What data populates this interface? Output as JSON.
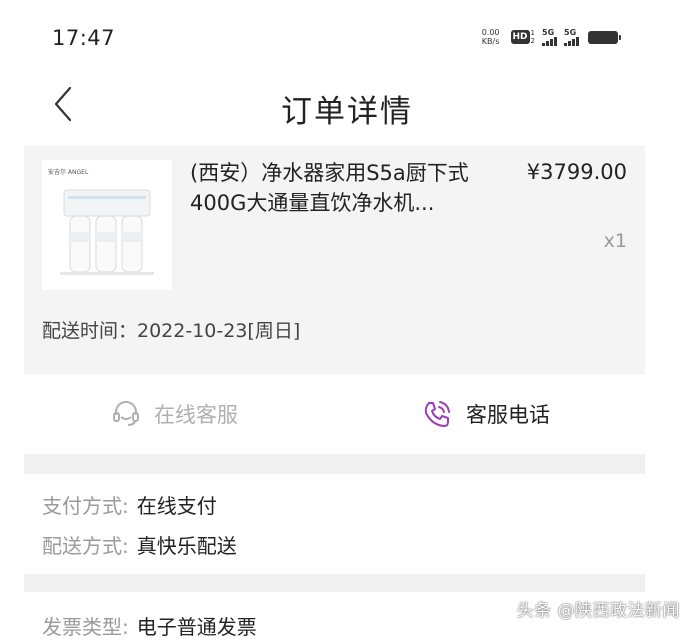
{
  "status_bar": {
    "time": "17:47",
    "net_speed_value": "0.00",
    "net_speed_unit": "KB/s",
    "hd_label": "HD",
    "hd_sub_top": "1",
    "hd_sub_bottom": "2",
    "signal_1_label": "5G",
    "signal_2_label": "5G"
  },
  "nav": {
    "title": "订单详情"
  },
  "product": {
    "brand_text": "安吉尔 ANGEL",
    "name": "(西安）净水器家用S5a厨下式400G大通量直饮净水机...",
    "price": "¥3799.00",
    "quantity": "x1",
    "delivery_time": "配送时间：2022-10-23[周日]"
  },
  "service": {
    "online_label": "在线客服",
    "phone_label": "客服电话"
  },
  "info": {
    "payment_label": "支付方式:",
    "payment_value": "在线支付",
    "delivery_label": "配送方式:",
    "delivery_value": "真快乐配送",
    "invoice_label": "发票类型:",
    "invoice_value": "电子普通发票"
  },
  "watermark": "头条 @陕西政法新闻",
  "colors": {
    "phone_icon": "#9b3fbf",
    "muted_text": "#9a9a9a",
    "card_bg": "#f4f4f4"
  }
}
